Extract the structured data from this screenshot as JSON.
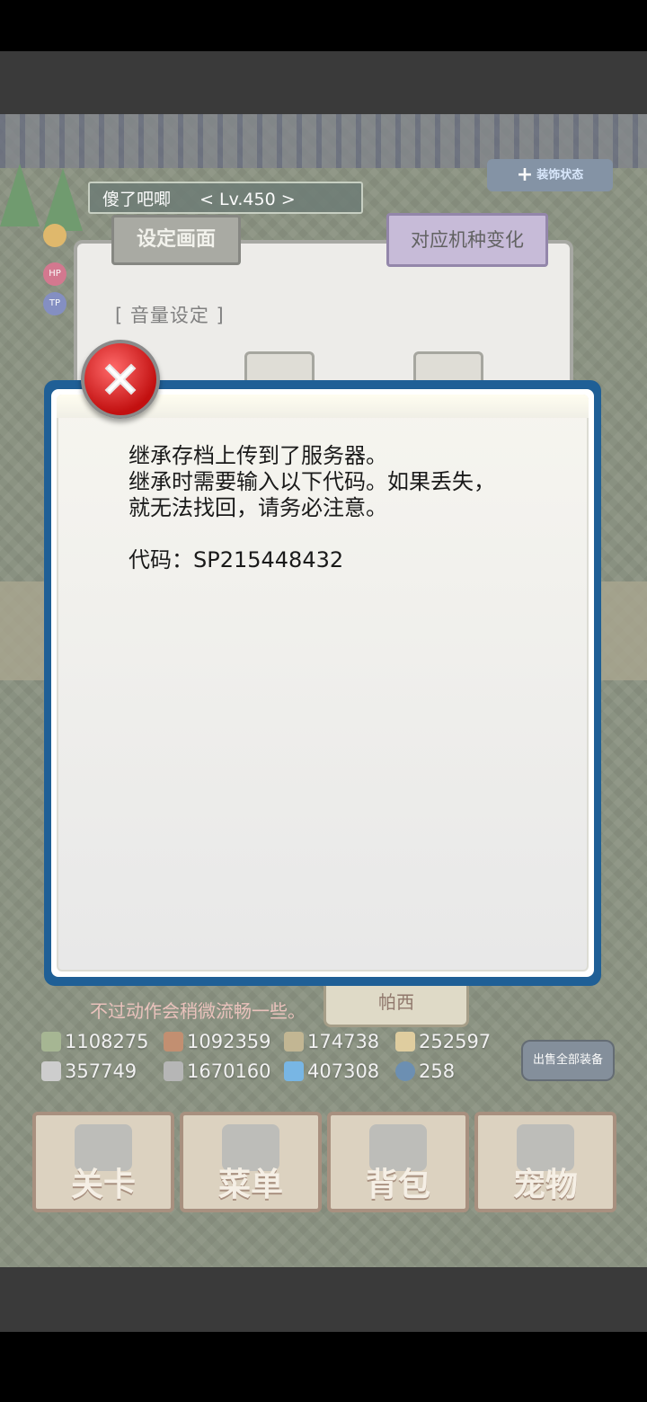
{
  "game": {
    "player_name": "傻了吧唧",
    "player_level": "< Lv.450 >",
    "status_button_label": "装饰状态",
    "settings_tab": "设定画面",
    "device_tab": "对应机种变化",
    "volume_heading": "[ 音量设定 ]",
    "hint_text": "不过动作会稍微流畅一些。",
    "equip_button": "帕西",
    "sell_all_button": "出售全部装备",
    "stats": {
      "row1": [
        "1108275",
        "1092359",
        "174738",
        "252597"
      ],
      "row2": [
        "357749",
        "1670160",
        "407308",
        "258"
      ]
    },
    "nav": {
      "stage": "关卡",
      "menu": "菜单",
      "bag": "背包",
      "pet": "宠物"
    }
  },
  "dialog": {
    "line1": "继承存档上传到了服务器。",
    "line2": "继承时需要输入以下代码。如果丢失，",
    "line3": "就无法找回，请务必注意。",
    "code_line": "代码：SP215448432"
  }
}
